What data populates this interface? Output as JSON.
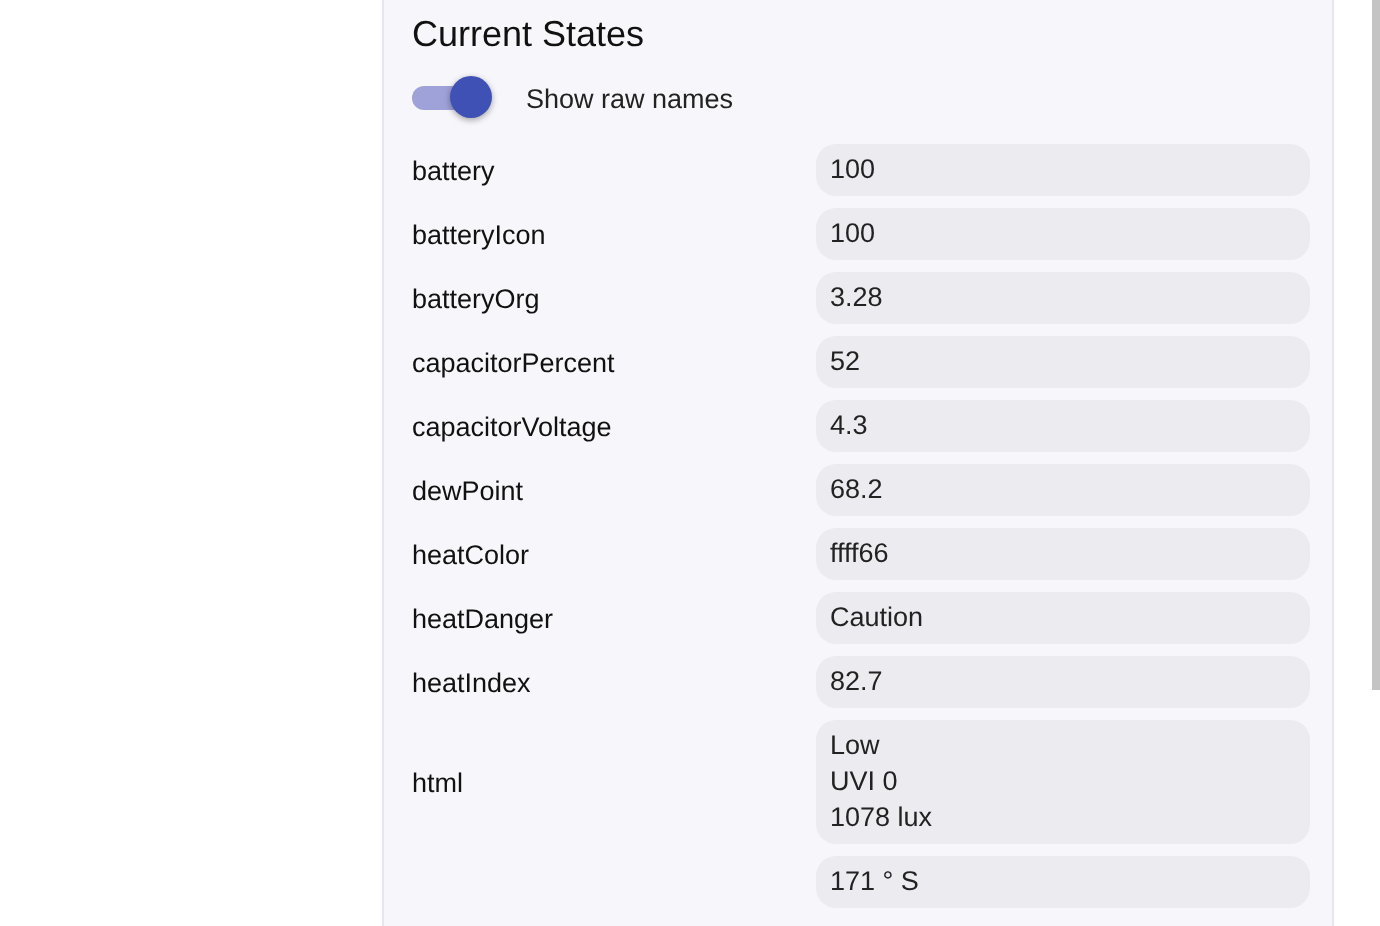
{
  "panel": {
    "title": "Current States",
    "toggle": {
      "label": "Show raw names",
      "on": true
    }
  },
  "states": [
    {
      "name": "battery",
      "value": [
        "100"
      ]
    },
    {
      "name": "batteryIcon",
      "value": [
        "100"
      ]
    },
    {
      "name": "batteryOrg",
      "value": [
        "3.28"
      ]
    },
    {
      "name": "capacitorPercent",
      "value": [
        "52"
      ]
    },
    {
      "name": "capacitorVoltage",
      "value": [
        "4.3"
      ]
    },
    {
      "name": "dewPoint",
      "value": [
        "68.2"
      ]
    },
    {
      "name": "heatColor",
      "value": [
        "ffff66"
      ]
    },
    {
      "name": "heatDanger",
      "value": [
        "Caution"
      ]
    },
    {
      "name": "heatIndex",
      "value": [
        "82.7"
      ]
    },
    {
      "name": "html",
      "value": [
        "Low",
        "UVI 0",
        "1078 lux"
      ]
    },
    {
      "value": [
        "171 ° S"
      ]
    }
  ]
}
